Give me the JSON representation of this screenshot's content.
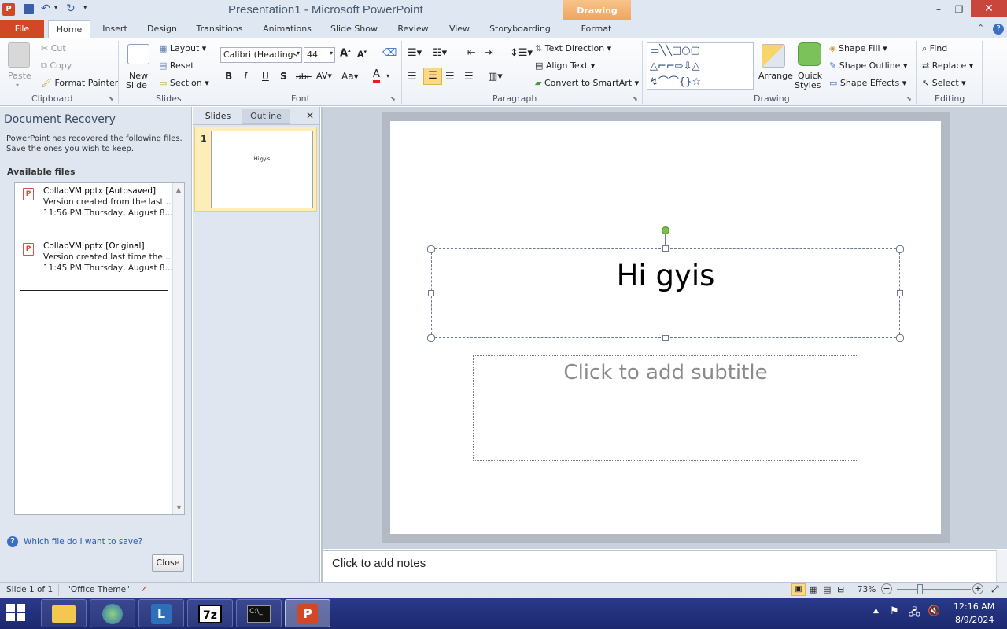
{
  "titlebar": {
    "title": "Presentation1 - Microsoft PowerPoint",
    "context_tab": "Drawing Tools"
  },
  "tabs": [
    "File",
    "Home",
    "Insert",
    "Design",
    "Transitions",
    "Animations",
    "Slide Show",
    "Review",
    "View",
    "Storyboarding",
    "Format"
  ],
  "ribbon": {
    "clipboard": {
      "paste": "Paste",
      "cut": "Cut",
      "copy": "Copy",
      "format_painter": "Format Painter",
      "label": "Clipboard"
    },
    "slides": {
      "new_slide": "New",
      "new_slide2": "Slide",
      "layout": "Layout",
      "reset": "Reset",
      "section": "Section",
      "label": "Slides"
    },
    "font": {
      "name": "Calibri (Headings",
      "size": "44",
      "label": "Font"
    },
    "paragraph": {
      "text_direction": "Text Direction",
      "align_text": "Align Text",
      "convert": "Convert to SmartArt",
      "label": "Paragraph"
    },
    "drawing": {
      "arrange": "Arrange",
      "quick": "Quick",
      "styles": "Styles",
      "shape_fill": "Shape Fill",
      "shape_outline": "Shape Outline",
      "shape_effects": "Shape Effects",
      "label": "Drawing"
    },
    "editing": {
      "find": "Find",
      "replace": "Replace",
      "select": "Select",
      "label": "Editing"
    }
  },
  "recovery": {
    "title": "Document Recovery",
    "message": "PowerPoint has recovered the following files. Save the ones you wish to keep.",
    "available": "Available files",
    "files": [
      {
        "name": "CollabVM.pptx  [Autosaved]",
        "line1": "Version created from the last ...",
        "line2": "11:56 PM Thursday, August 8..."
      },
      {
        "name": "CollabVM.pptx  [Original]",
        "line1": "Version created last time the ...",
        "line2": "11:45 PM Thursday, August 8..."
      }
    ],
    "help_link": "Which file do I want to save?",
    "close": "Close"
  },
  "slides_pane": {
    "tab_slides": "Slides",
    "tab_outline": "Outline",
    "slide_num": "1",
    "thumb_text": "Hi gyis"
  },
  "slide": {
    "title": "Hi gyis",
    "subtitle_placeholder": "Click to add subtitle"
  },
  "notes": {
    "placeholder": "Click to add notes"
  },
  "status": {
    "slide": "Slide 1 of 1",
    "theme": "\"Office Theme\"",
    "zoom": "73%"
  },
  "taskbar": {
    "time": "12:16 AM",
    "date": "8/9/2024"
  },
  "colors": {
    "file_tab": "#d24726",
    "context_tab": "#f0a35e",
    "taskbar": "#1c2870"
  }
}
